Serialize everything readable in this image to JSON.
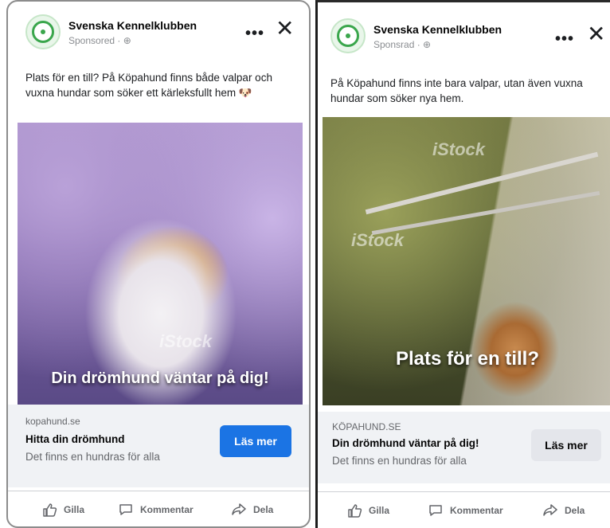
{
  "ads": [
    {
      "page_name": "Svenska Kennelklubben",
      "sponsored": "Sponsored · ⊕",
      "text": "Plats för en till? På Köpahund finns både valpar och vuxna hundar som söker ett kärleksfullt hem 🐶",
      "image_caption": "Din drömhund väntar på dig!",
      "watermark": "iStock",
      "domain": "kopahund.se",
      "headline": "Hitta din drömhund",
      "description": "Det finns en hundras för alla",
      "cta_label": "Läs mer",
      "like_label": "Gilla",
      "comment_label": "Kommentar",
      "share_label": "Dela"
    },
    {
      "page_name": "Svenska Kennelklubben",
      "sponsored": "Sponsrad · ⊕",
      "text": "På Köpahund finns inte bara valpar, utan även vuxna hundar som söker nya hem.",
      "image_caption": "Plats för en till?",
      "watermark": "iStock",
      "domain": "KÖPAHUND.SE",
      "headline": "Din drömhund väntar på dig!",
      "description": "Det finns en hundras för alla",
      "cta_label": "Läs mer",
      "like_label": "Gilla",
      "comment_label": "Kommentar",
      "share_label": "Dela"
    }
  ],
  "colors": {
    "primary_cta": "#1b74e4",
    "secondary_cta": "#e4e6eb",
    "meta_text": "#65676b"
  }
}
